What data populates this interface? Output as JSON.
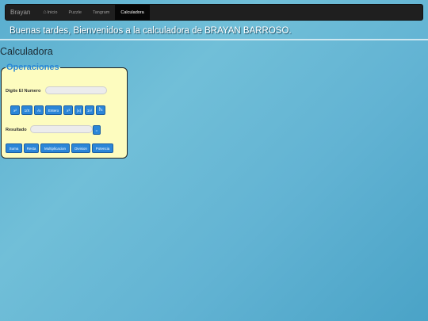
{
  "navbar": {
    "brand": "Brayan",
    "items": [
      {
        "label": "Inicio",
        "icon": "home-icon"
      },
      {
        "label": "Puzzle"
      },
      {
        "label": "Tangram"
      },
      {
        "label": "Calculadora",
        "active": true
      }
    ]
  },
  "greeting": "Buenas tardes, Bienvenidos a la calculadora de BRAYAN BARROSO.",
  "page_title": "Calculadora",
  "panel": {
    "legend": "Operaciones",
    "number_label": "Digite El Numero",
    "number_value": "",
    "function_buttons": [
      "x²",
      "1/X",
      "√x",
      "Entero",
      "x³",
      "|x|",
      "1/√",
      "∛x"
    ],
    "result_label": "Resultado",
    "result_value": "",
    "side_button": "=",
    "operation_buttons": [
      "Suma",
      "Resta",
      "Multiplicacion",
      "Division",
      "Potencia"
    ]
  },
  "colors": {
    "background": "#62b3d3",
    "navbar": "#1f1f1f",
    "panel": "#fdfcbf",
    "accent": "#2b86d8",
    "legend": "#2b87d4"
  }
}
